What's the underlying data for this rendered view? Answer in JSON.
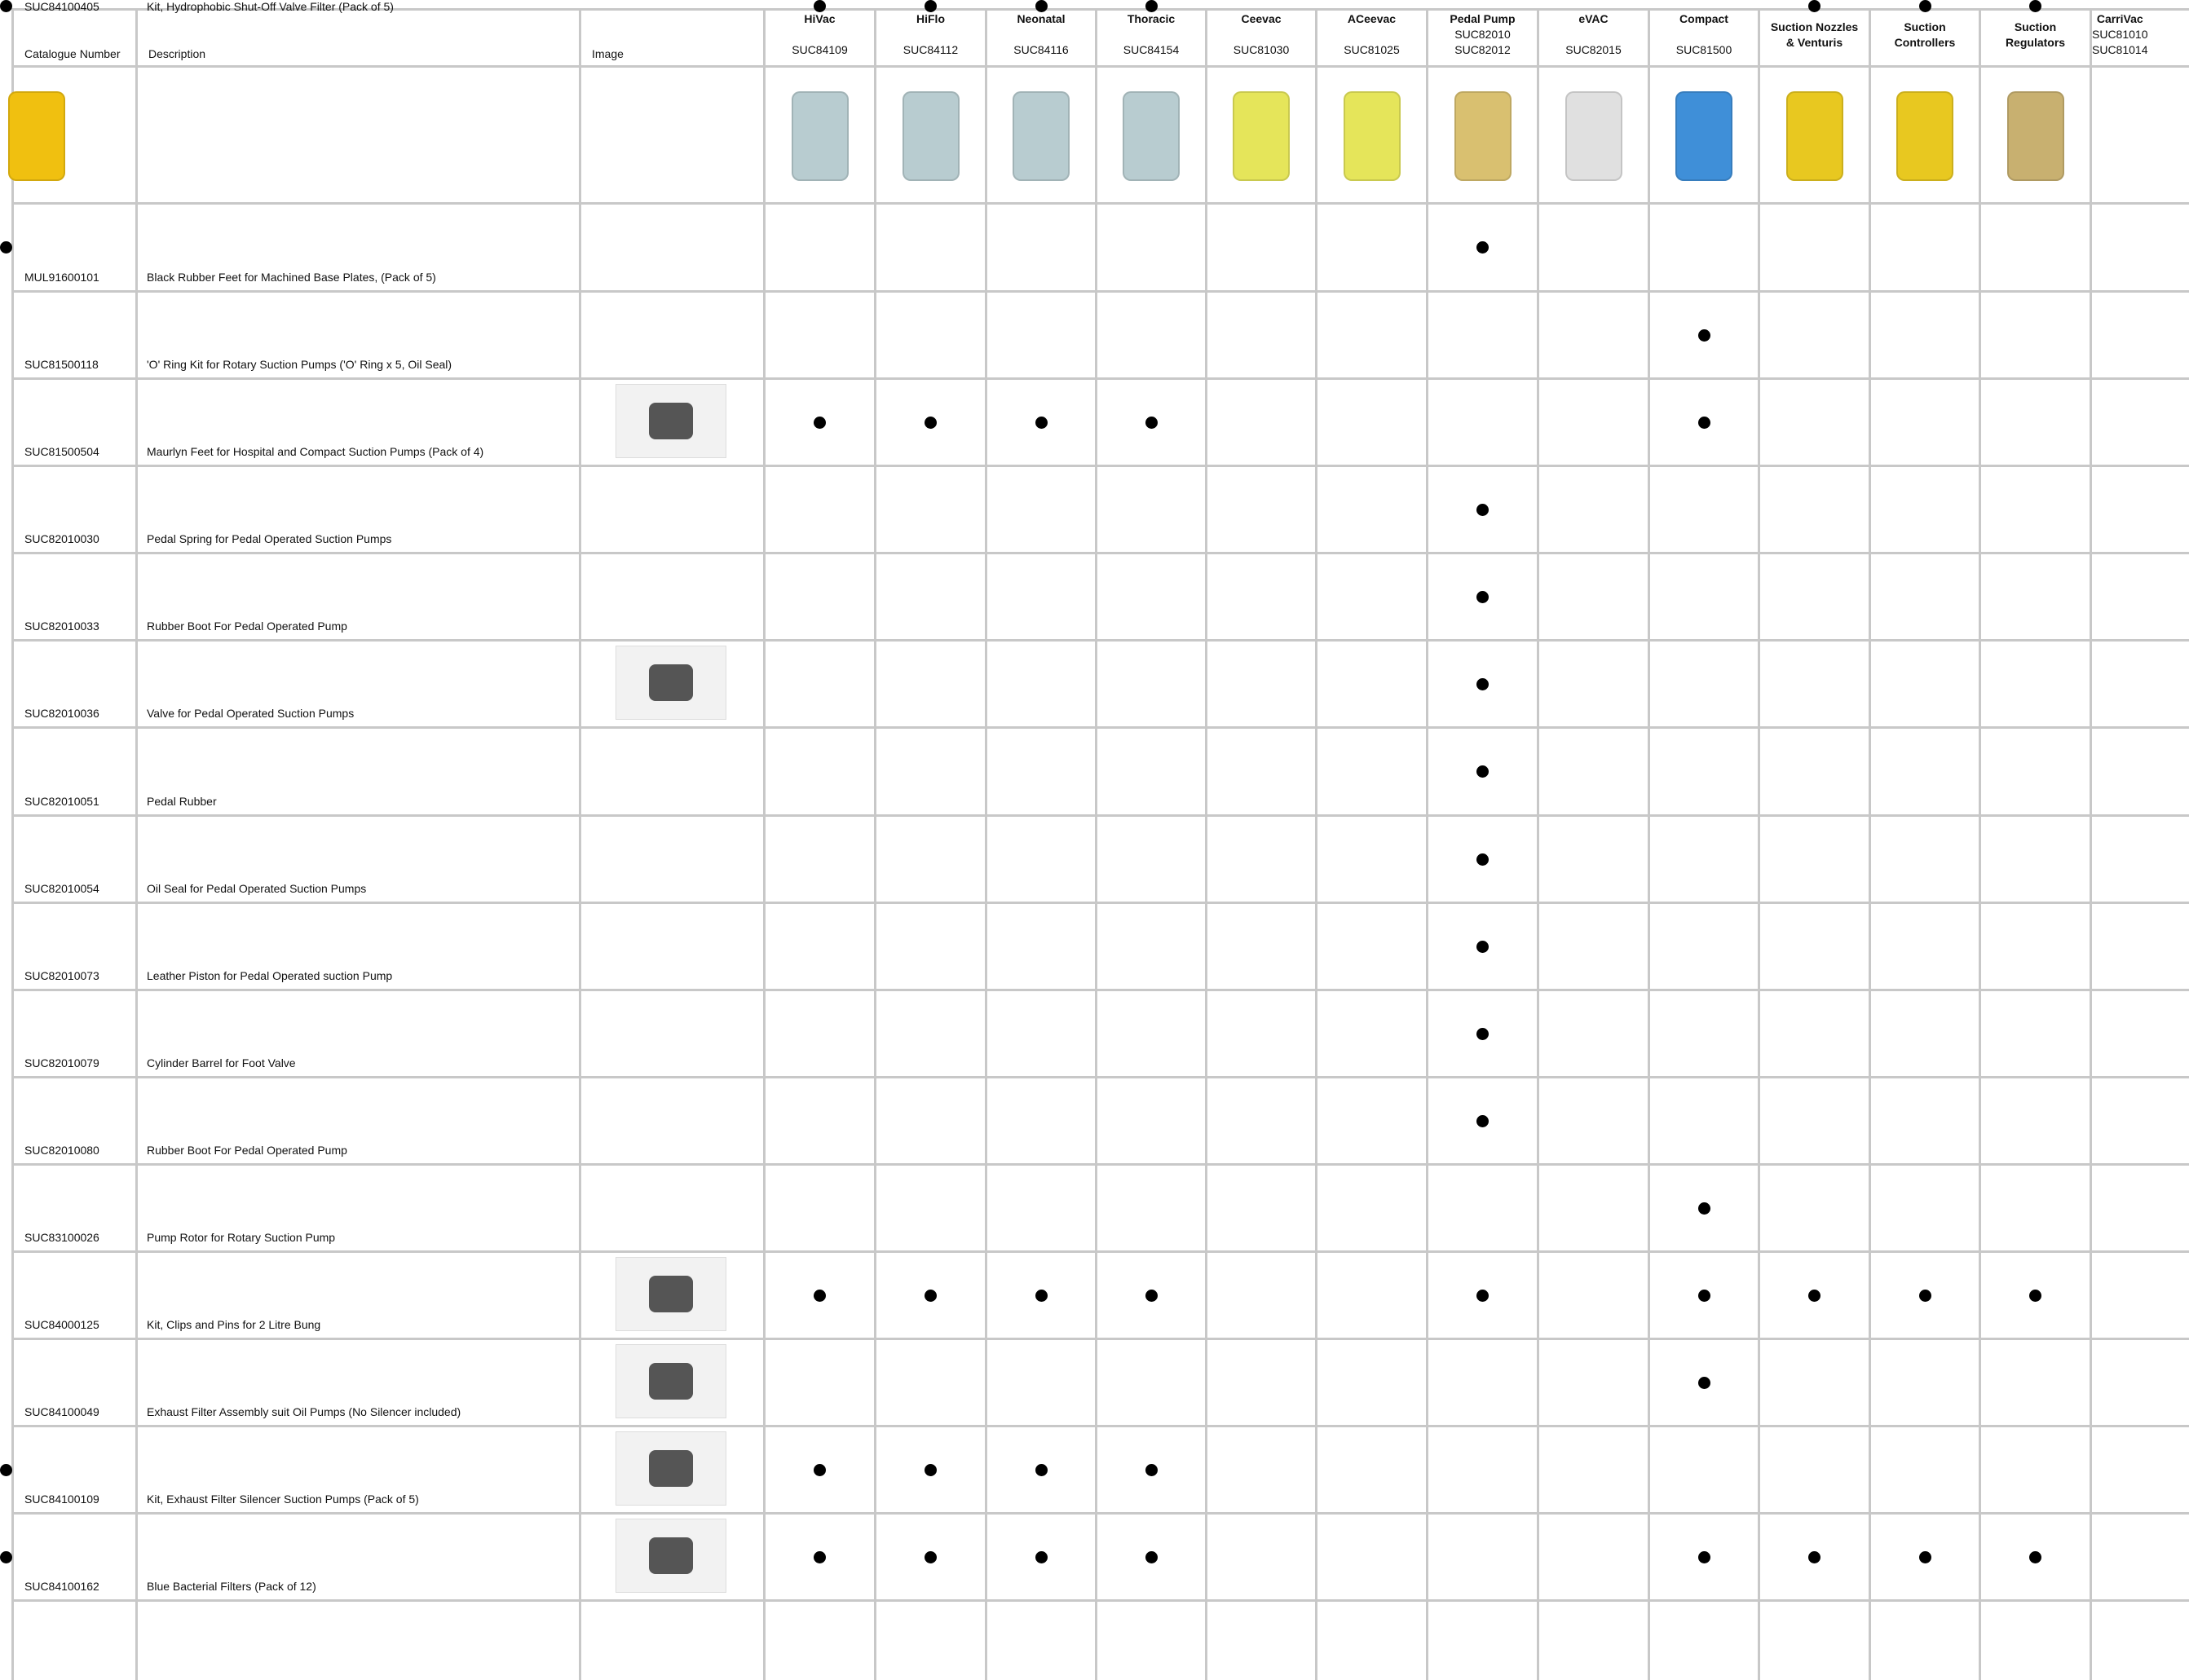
{
  "headers": {
    "catalogue": "Catalogue Number",
    "description": "Description",
    "image": "Image"
  },
  "products": [
    {
      "name": "HiVac",
      "code": "SUC84109",
      "code2": "",
      "image": "trolley-suction-unit",
      "color": "#b8ccd0"
    },
    {
      "name": "HiFlo",
      "code": "SUC84112",
      "code2": "",
      "image": "trolley-suction-unit",
      "color": "#b8ccd0"
    },
    {
      "name": "Neonatal",
      "code": "SUC84116",
      "code2": "",
      "image": "trolley-suction-unit",
      "color": "#b8ccd0"
    },
    {
      "name": "Thoracic",
      "code": "SUC84154",
      "code2": "",
      "image": "trolley-suction-unit",
      "color": "#b8ccd0"
    },
    {
      "name": "Ceevac",
      "code": "SUC81030",
      "code2": "",
      "image": "portable-suction-unit",
      "color": "#e5e55a"
    },
    {
      "name": "ACeevac",
      "code": "SUC81025",
      "code2": "",
      "image": "portable-suction-unit",
      "color": "#e5e55a"
    },
    {
      "name": "Pedal Pump",
      "code": "SUC82010",
      "code2": "SUC82012",
      "image": "pedal-pump",
      "color": "#d9c070"
    },
    {
      "name": "eVAC",
      "code": "SUC82015",
      "code2": "",
      "image": "hand-suction-pump",
      "color": "#e0e0e0"
    },
    {
      "name": "Compact",
      "code": "SUC81500",
      "code2": "",
      "image": "compact-suction-unit",
      "color": "#3f8fd8"
    },
    {
      "name": "Suction Nozzles & Venturis",
      "code": "",
      "code2": "",
      "image": "suction-nozzles",
      "color": "#e8c820"
    },
    {
      "name": "Suction Controllers",
      "code": "",
      "code2": "",
      "image": "suction-controller",
      "color": "#e8c820"
    },
    {
      "name": "Suction Regulators",
      "code": "",
      "code2": "",
      "image": "suction-regulator",
      "color": "#c8b070"
    },
    {
      "name": "CarriVac",
      "code": "SUC81010",
      "code2": "SUC81014",
      "image": "carrivac-unit",
      "color": "#f0c010"
    }
  ],
  "rows": [
    {
      "cat": "MUL91600101",
      "desc": "Black Rubber Feet for Machined Base Plates, (Pack of 5)",
      "image": "",
      "marks": [
        6,
        12
      ]
    },
    {
      "cat": "SUC81500118",
      "desc": "'O' Ring Kit for Rotary Suction Pumps ('O' Ring x 5, Oil Seal)",
      "image": "",
      "marks": [
        8
      ]
    },
    {
      "cat": "SUC81500504",
      "desc": "Maurlyn Feet for Hospital and Compact Suction Pumps (Pack of 4)",
      "image": "rubber-foot-photo",
      "marks": [
        0,
        1,
        2,
        3,
        8
      ]
    },
    {
      "cat": "SUC82010030",
      "desc": "Pedal Spring for Pedal Operated Suction Pumps",
      "image": "",
      "marks": [
        6
      ]
    },
    {
      "cat": "SUC82010033",
      "desc": "Rubber Boot For Pedal Operated Pump",
      "image": "",
      "marks": [
        6
      ]
    },
    {
      "cat": "SUC82010036",
      "desc": "Valve for Pedal Operated Suction Pumps",
      "image": "valve-washer-photo",
      "marks": [
        6
      ]
    },
    {
      "cat": "SUC82010051",
      "desc": "Pedal Rubber",
      "image": "",
      "marks": [
        6
      ]
    },
    {
      "cat": "SUC82010054",
      "desc": "Oil Seal for Pedal Operated Suction Pumps",
      "image": "",
      "marks": [
        6
      ]
    },
    {
      "cat": "SUC82010073",
      "desc": "Leather Piston for Pedal Operated suction Pump",
      "image": "",
      "marks": [
        6
      ]
    },
    {
      "cat": "SUC82010079",
      "desc": "Cylinder Barrel for Foot Valve",
      "image": "",
      "marks": [
        6
      ]
    },
    {
      "cat": "SUC82010080",
      "desc": "Rubber Boot For Pedal Operated Pump",
      "image": "",
      "marks": [
        6
      ]
    },
    {
      "cat": "SUC83100026",
      "desc": "Pump Rotor for Rotary Suction Pump",
      "image": "",
      "marks": [
        8
      ]
    },
    {
      "cat": "SUC84000125",
      "desc": "Kit, Clips and Pins for 2 Litre Bung",
      "image": "clips-pins-photo",
      "marks": [
        0,
        1,
        2,
        3,
        6,
        8,
        9,
        10,
        11
      ]
    },
    {
      "cat": "SUC84100049",
      "desc": "Exhaust Filter Assembly suit Oil Pumps (No Silencer included)",
      "image": "filter-assembly-photo",
      "marks": [
        8
      ]
    },
    {
      "cat": "SUC84100109",
      "desc": "Kit, Exhaust Filter Silencer Suction Pumps (Pack of 5)",
      "image": "silencer-photo",
      "marks": [
        0,
        1,
        2,
        3,
        12
      ]
    },
    {
      "cat": "SUC84100162",
      "desc": "Blue Bacterial Filters (Pack of 12)",
      "image": "blue-filter-photo",
      "marks": [
        0,
        1,
        2,
        3,
        8,
        9,
        10,
        11,
        12
      ]
    },
    {
      "cat": "SUC84100405",
      "desc": "Kit, Hydrophobic Shut-Off Valve Filter (Pack of 5)",
      "image": "valve-filter-photo",
      "marks": [
        0,
        1,
        2,
        3,
        9,
        10,
        11,
        12
      ]
    }
  ]
}
